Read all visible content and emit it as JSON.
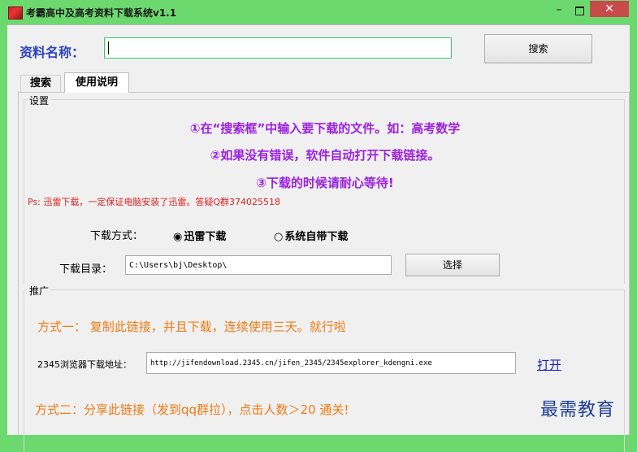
{
  "window": {
    "title": "考霸高中及高考资料下载系统v1.1",
    "minimize_glyph": "–",
    "close_glyph": "✕"
  },
  "search": {
    "label": "资料名称：",
    "value": "",
    "button_label": "搜索"
  },
  "tabs": [
    {
      "label": "搜索",
      "active": false
    },
    {
      "label": "使用说明",
      "active": true
    }
  ],
  "settings": {
    "group_title": "设置",
    "instructions": [
      "①在“搜索框”中输入要下载的文件。如：高考数学",
      "②如果没有错误，软件自动打开下载链接。",
      "③下载的时候请耐心等待!"
    ],
    "ps_note": "Ps: 迅雷下载，一定保证电脑安装了迅雷。答疑Q群374025518",
    "download_method_label": "下载方式：",
    "methods": [
      {
        "label": "迅雷下载",
        "selected": true
      },
      {
        "label": "系统自带下载",
        "selected": false
      }
    ],
    "radio_on": "◉",
    "radio_off": "○",
    "dir_label": "下载目录：",
    "dir_value": "C:\\Users\\bj\\Desktop\\",
    "choose_button": "选择"
  },
  "promo": {
    "group_title": "推广",
    "method1": "方式一：  复制此链接，并且下载，连续使用三天。就行啦",
    "browser_label": "2345浏览器下载地址：",
    "browser_url": "http://jifendownload.2345.cn/jifen_2345/2345explorer_kdengni.exe",
    "open_link": "打开",
    "method2": "方式二：分享此链接（发到qq群拉），点击人数＞20 通关!"
  },
  "watermark": "最需教育",
  "colors": {
    "window_frame": "#6cd96e",
    "label_blue": "#2e44c4",
    "instruction_purple": "#9b22e0",
    "ps_red": "#e02020",
    "promo_orange": "#f07a14",
    "link_blue": "#1a1ad0",
    "close_red": "#c84b4b"
  },
  "icons": {
    "app": "app-logo-icon",
    "minimize": "minimize-icon",
    "maximize": "maximize-icon",
    "close": "close-icon"
  }
}
